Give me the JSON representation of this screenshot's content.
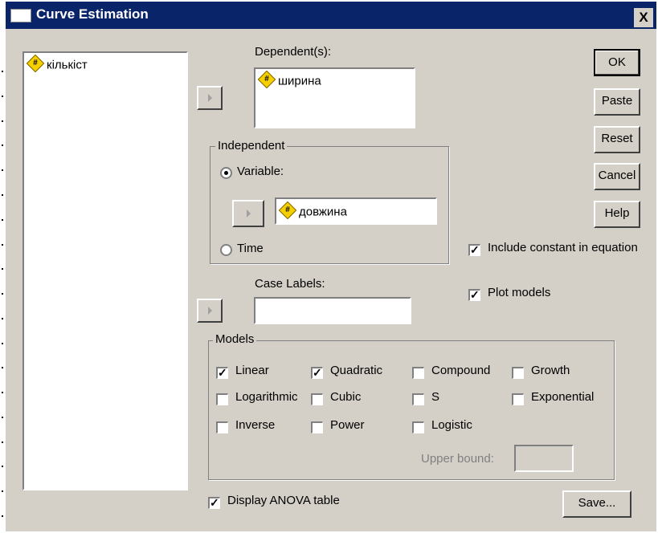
{
  "window": {
    "title": "Curve Estimation",
    "close_glyph": "X"
  },
  "source_list": {
    "items": [
      {
        "label": "кількіст",
        "icon": "numeric-variable-icon"
      }
    ]
  },
  "dependent": {
    "label": "Dependent(s):",
    "items": [
      {
        "label": "ширина",
        "icon": "numeric-variable-icon"
      }
    ]
  },
  "independent": {
    "legend": "Independent",
    "variable_option": "Variable:",
    "variable_value": "довжина",
    "time_option": "Time",
    "selected": "Variable"
  },
  "case_labels": {
    "label": "Case Labels:",
    "value": ""
  },
  "buttons": {
    "ok": "OK",
    "paste": "Paste",
    "reset": "Reset",
    "cancel": "Cancel",
    "help": "Help",
    "save": "Save..."
  },
  "options": {
    "include_constant": {
      "label": "Include constant in equation",
      "checked": true
    },
    "plot_models": {
      "label": "Plot models",
      "checked": true
    },
    "display_anova": {
      "label": "Display ANOVA table",
      "checked": true
    }
  },
  "models": {
    "legend": "Models",
    "items": [
      {
        "label": "Linear",
        "checked": true
      },
      {
        "label": "Quadratic",
        "checked": true
      },
      {
        "label": "Compound",
        "checked": false
      },
      {
        "label": "Growth",
        "checked": false
      },
      {
        "label": "Logarithmic",
        "checked": false
      },
      {
        "label": "Cubic",
        "checked": false
      },
      {
        "label": "S",
        "checked": false
      },
      {
        "label": "Exponential",
        "checked": false
      },
      {
        "label": "Inverse",
        "checked": false
      },
      {
        "label": "Power",
        "checked": false
      },
      {
        "label": "Logistic",
        "checked": false
      }
    ],
    "upper_bound": {
      "label": "Upper bound:",
      "value": "",
      "enabled": false
    }
  },
  "icon_glyph": "#"
}
